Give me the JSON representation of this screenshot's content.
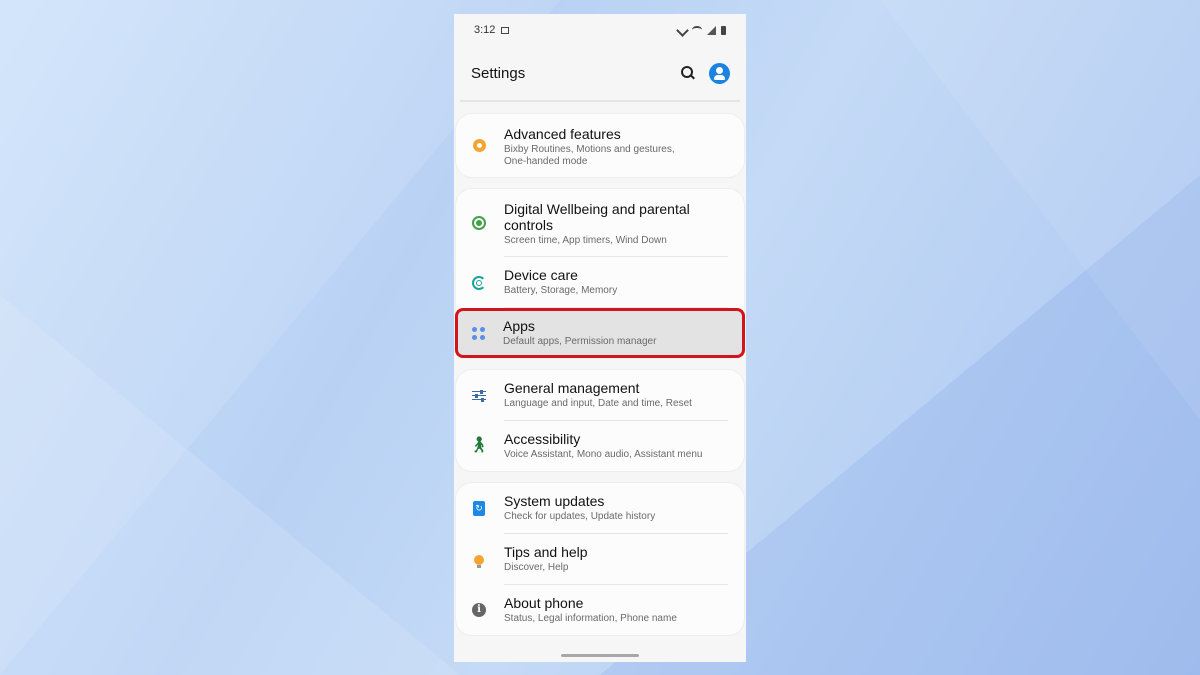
{
  "status_bar": {
    "time": "3:12"
  },
  "header": {
    "title": "Settings"
  },
  "groups": [
    {
      "items": [
        {
          "label": "Advanced features",
          "sub": "Bixby Routines, Motions and gestures, One-handed mode",
          "icon": "advanced-features-icon"
        }
      ]
    },
    {
      "items": [
        {
          "label": "Digital Wellbeing and parental controls",
          "sub": "Screen time, App timers, Wind Down",
          "icon": "digital-wellbeing-icon"
        },
        {
          "label": "Device care",
          "sub": "Battery, Storage, Memory",
          "icon": "device-care-icon"
        },
        {
          "label": "Apps",
          "sub": "Default apps, Permission manager",
          "icon": "apps-grid-icon",
          "highlighted": true
        }
      ]
    },
    {
      "items": [
        {
          "label": "General management",
          "sub": "Language and input, Date and time, Reset",
          "icon": "sliders-icon"
        },
        {
          "label": "Accessibility",
          "sub": "Voice Assistant, Mono audio, Assistant menu",
          "icon": "accessibility-icon"
        }
      ]
    },
    {
      "items": [
        {
          "label": "System updates",
          "sub": "Check for updates, Update history",
          "icon": "system-update-icon"
        },
        {
          "label": "Tips and help",
          "sub": "Discover, Help",
          "icon": "lightbulb-icon"
        },
        {
          "label": "About phone",
          "sub": "Status, Legal information, Phone name",
          "icon": "info-icon"
        }
      ]
    }
  ],
  "colors": {
    "highlight_border": "#d4141b",
    "avatar": "#1a84e0"
  }
}
